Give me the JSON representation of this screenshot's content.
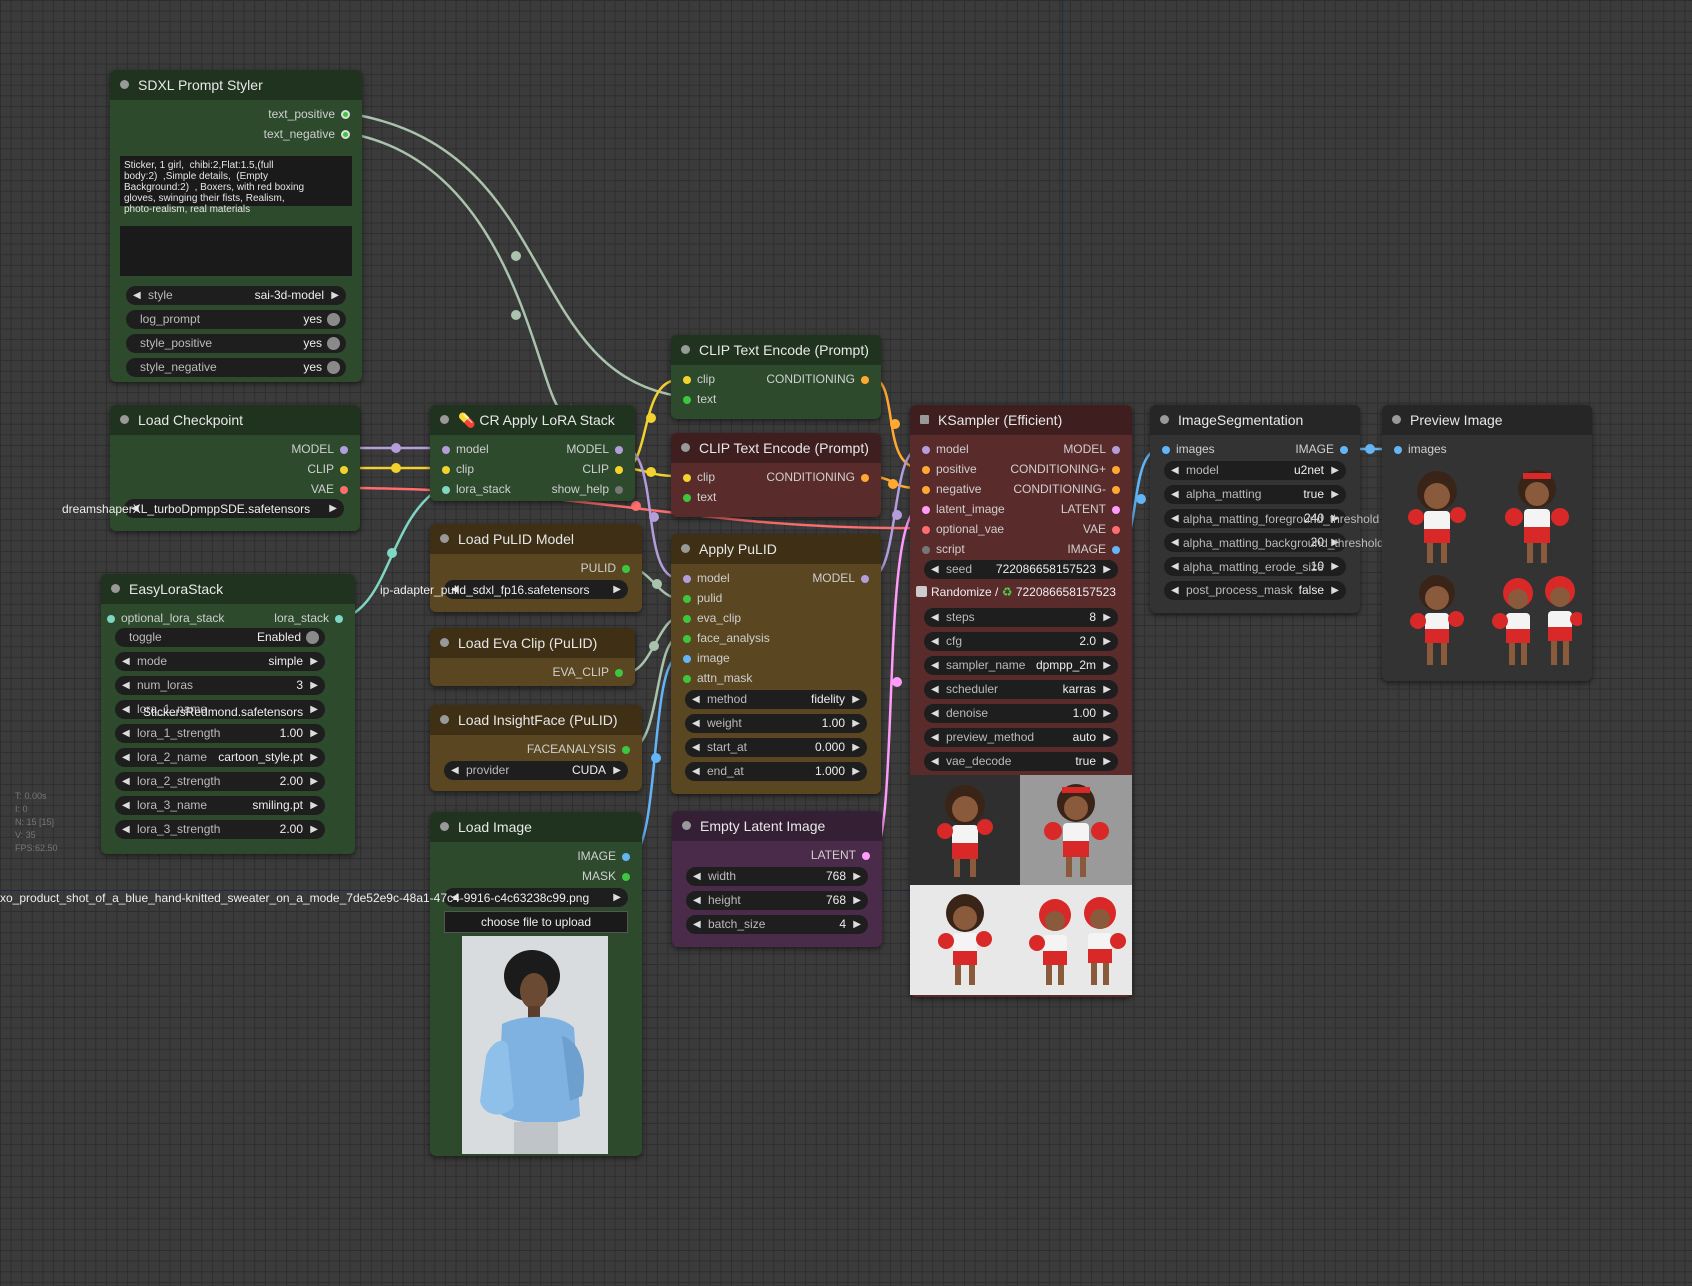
{
  "colors": {
    "model": "#b39ddb",
    "clip": "#f2d22e",
    "vae": "#ff6e6e",
    "conditioning": "#ffa931",
    "latent": "#ff9cf9",
    "image": "#64b5f6",
    "lora": "#7fd6c2",
    "pulid": "#3ec73e",
    "misc": "#c8d8c8"
  },
  "stats": [
    "T: 0.00s",
    "I: 0",
    "N: 15 [15]",
    "V: 35",
    "FPS:62.50"
  ],
  "overlays": {
    "ckpt_name": "dreamshaperXL_turboDpmppSDE.safetensors",
    "pulid_file": "ip-adapter_pulid_sdxl_fp16.safetensors",
    "image_file": "xo_product_shot_of_a_blue_hand-knitted_sweater_on_a_mode_7de52e9c-48a1-47c4-9916-c4c63238c99.png",
    "lora_1_name": "StickersRedmond.safetensors",
    "alpha_fg": "alpha_matting_foreground_threshold",
    "alpha_bg": "alpha_matting_background_threshold",
    "alpha_er": "alpha_matting_erode_size"
  },
  "styler": {
    "title": "SDXL Prompt Styler",
    "outputs": [
      "text_positive",
      "text_negative"
    ],
    "prompt": "Sticker, 1 girl,  chibi:2,Flat:1.5,(full\nbody:2)  ,Simple details,  (Empty\nBackground:2)  , Boxers, with red boxing\ngloves, swinging their fists, Realism,\nphoto-realism, real materials",
    "style_label": "style",
    "style_value": "sai-3d-model",
    "log_prompt": "log_prompt",
    "log_prompt_value": "yes",
    "style_positive": "style_positive",
    "style_positive_value": "yes",
    "style_negative": "style_negative",
    "style_negative_value": "yes"
  },
  "ckpt": {
    "title": "Load Checkpoint",
    "outputs": [
      "MODEL",
      "CLIP",
      "VAE"
    ]
  },
  "lora_stack": {
    "title": "CR Apply LoRA Stack",
    "icon": "💊",
    "inputs": [
      "model",
      "clip",
      "lora_stack"
    ],
    "outputs": [
      "MODEL",
      "CLIP",
      "show_help"
    ]
  },
  "easylora": {
    "title": "EasyLoraStack",
    "input": "optional_lora_stack",
    "output": "lora_stack",
    "widgets": [
      {
        "l": "toggle",
        "v": "Enabled"
      },
      {
        "l": "mode",
        "v": "simple"
      },
      {
        "l": "num_loras",
        "v": "3"
      },
      {
        "l": "lora_1_name",
        "v": ""
      },
      {
        "l": "lora_1_strength",
        "v": "1.00"
      },
      {
        "l": "lora_2_name",
        "v": "cartoon_style.pt"
      },
      {
        "l": "lora_2_strength",
        "v": "2.00"
      },
      {
        "l": "lora_3_name",
        "v": "smiling.pt"
      },
      {
        "l": "lora_3_strength",
        "v": "2.00"
      }
    ]
  },
  "clip1": {
    "title": "CLIP Text Encode (Prompt)",
    "inputs": [
      "clip",
      "text"
    ],
    "output": "CONDITIONING"
  },
  "clip2": {
    "title": "CLIP Text Encode (Prompt)",
    "inputs": [
      "clip",
      "text"
    ],
    "output": "CONDITIONING"
  },
  "pulid_model": {
    "title": "Load PuLID Model",
    "output": "PULID"
  },
  "eva": {
    "title": "Load Eva Clip (PuLID)",
    "output": "EVA_CLIP"
  },
  "insight": {
    "title": "Load InsightFace (PuLID)",
    "output": "FACEANALYSIS",
    "w_label": "provider",
    "w_value": "CUDA"
  },
  "apply_pulid": {
    "title": "Apply PuLID",
    "inputs": [
      "model",
      "pulid",
      "eva_clip",
      "face_analysis",
      "image",
      "attn_mask"
    ],
    "output": "MODEL",
    "widgets": [
      {
        "l": "method",
        "v": "fidelity"
      },
      {
        "l": "weight",
        "v": "1.00"
      },
      {
        "l": "start_at",
        "v": "0.000"
      },
      {
        "l": "end_at",
        "v": "1.000"
      }
    ]
  },
  "load_image": {
    "title": "Load Image",
    "outputs": [
      "IMAGE",
      "MASK"
    ],
    "upload": "choose file to upload"
  },
  "empty_latent": {
    "title": "Empty Latent Image",
    "output": "LATENT",
    "widgets": [
      {
        "l": "width",
        "v": "768"
      },
      {
        "l": "height",
        "v": "768"
      },
      {
        "l": "batch_size",
        "v": "4"
      }
    ]
  },
  "ksampler": {
    "title": "KSampler (Efficient)",
    "inputs": [
      "model",
      "positive",
      "negative",
      "latent_image",
      "optional_vae",
      "script"
    ],
    "outputs": [
      "MODEL",
      "CONDITIONING+",
      "CONDITIONING-",
      "LATENT",
      "VAE",
      "IMAGE"
    ],
    "seed_label": "seed",
    "seed": "722086658157523",
    "randomize": "Randomize / ",
    "randomize_seed": "722086658157523",
    "widgets": [
      {
        "l": "steps",
        "v": "8"
      },
      {
        "l": "cfg",
        "v": "2.0"
      },
      {
        "l": "sampler_name",
        "v": "dpmpp_2m"
      },
      {
        "l": "scheduler",
        "v": "karras"
      },
      {
        "l": "denoise",
        "v": "1.00"
      },
      {
        "l": "preview_method",
        "v": "auto"
      },
      {
        "l": "vae_decode",
        "v": "true"
      }
    ]
  },
  "segmentation": {
    "title": "ImageSegmentation",
    "input": "images",
    "output": "IMAGE",
    "widgets": [
      {
        "l": "model",
        "v": "u2net"
      },
      {
        "l": "alpha_matting",
        "v": "true"
      },
      {
        "l": "",
        "v": "240"
      },
      {
        "l": "",
        "v": "20"
      },
      {
        "l": "",
        "v": "10"
      },
      {
        "l": "post_process_mask",
        "v": "false"
      }
    ]
  },
  "preview": {
    "title": "Preview Image",
    "input": "images"
  }
}
